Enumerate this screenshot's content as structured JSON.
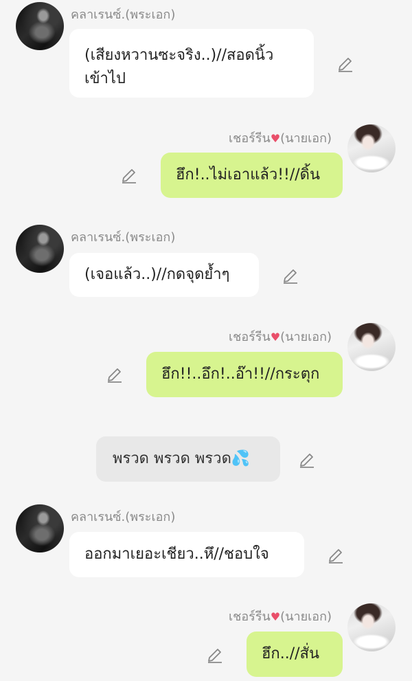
{
  "messages": [
    {
      "sender": "คลาเรนซ์.(พระเอก)",
      "text": "(เสียงหวานซะจริง..)//สอดนิ้วเข้าไป",
      "text_line1": "(เสียงหวานซะจริง..)//สอดนิ้ว",
      "text_line2": "เข้าไป"
    },
    {
      "sender": "เชอร์รีน",
      "sender_suffix": "(นายเอก)",
      "text": "ฮึก!..ไม่เอาแล้ว!!//ดิ้น"
    },
    {
      "sender": "คลาเรนซ์.(พระเอก)",
      "text": "(เจอแล้ว..)//กดจุดย้ำๆ"
    },
    {
      "sender": "เชอร์รีน",
      "sender_suffix": "(นายเอก)",
      "text": "ฮึก!!..อึก!..อ๊า!!//กระตุก"
    },
    {
      "narration": "พรวด พรวด พรวด"
    },
    {
      "sender": "คลาเรนซ์.(พระเอก)",
      "text": "ออกมาเยอะเชียว..หึ//ชอบใจ"
    },
    {
      "sender": "เชอร์รีน",
      "sender_suffix": "(นายเอก)",
      "text": "ฮึก..//สั่น"
    }
  ],
  "icons": {
    "edit": "pencil-icon",
    "heart": "heart-icon",
    "droplets": "sweat-droplets-icon"
  },
  "colors": {
    "background": "#f5f5f5",
    "left_bubble": "#ffffff",
    "right_bubble": "#d7f48f",
    "narration_bubble": "#e8e8e8",
    "name_text": "#8a8a8a"
  }
}
